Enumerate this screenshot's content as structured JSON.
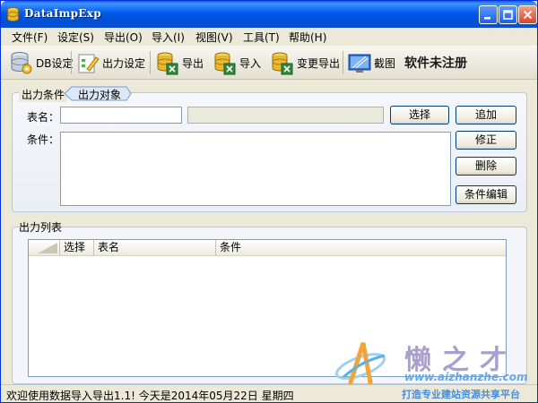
{
  "window": {
    "title": "DataImpExp",
    "unregistered": "软件未注册"
  },
  "menu": {
    "items": [
      "文件(F)",
      "设定(S)",
      "导出(O)",
      "导入(I)",
      "视图(V)",
      "工具(T)",
      "帮助(H)"
    ]
  },
  "toolbar": {
    "db_settings": "DB设定",
    "output_settings": "出力设定",
    "export": "导出",
    "import": "导入",
    "change_export": "变更导出",
    "screenshot": "截图"
  },
  "condition_group": {
    "title": "出力条件",
    "tab": "出力对象",
    "table_label": "表名：",
    "condition_label": "条件：",
    "table_value": "",
    "condition_value": "",
    "buttons": {
      "select": "选择",
      "add": "追加",
      "edit": "修正",
      "delete": "删除",
      "condition_edit": "条件编辑"
    }
  },
  "list_group": {
    "title": "出力列表",
    "columns": [
      "",
      "选择",
      "表名",
      "条件"
    ],
    "rows": []
  },
  "status": {
    "text": "欢迎使用数据导入导出1.1! 今天是2014年05月22日   星期四"
  },
  "watermark": {
    "name": "懒之才",
    "url": "www.aizhanzhe.com",
    "tagline": "打造专业建站资源共享平台"
  },
  "colors": {
    "titlebar": "#0058ee",
    "window_bg": "#ece9d8",
    "group_border": "#b6c6dc",
    "watermark_purple": "#8b7fc0",
    "watermark_blue": "#4a8ed6"
  }
}
